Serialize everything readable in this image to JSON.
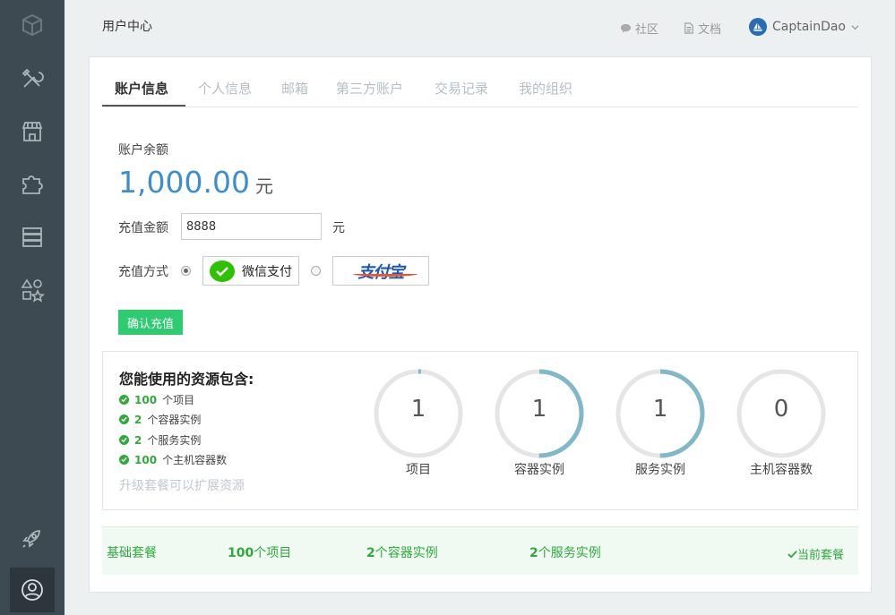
{
  "header": {
    "title": "用户中心",
    "community_label": "社区",
    "docs_label": "文档",
    "username": "CaptainDao"
  },
  "sidebar": {
    "items": [
      {
        "icon": "logo-cube-icon"
      },
      {
        "icon": "tools-icon"
      },
      {
        "icon": "store-icon"
      },
      {
        "icon": "puzzle-icon"
      },
      {
        "icon": "server-icon"
      },
      {
        "icon": "shapes-icon"
      },
      {
        "icon": "rocket-icon"
      },
      {
        "icon": "user-icon",
        "active": true
      }
    ]
  },
  "tabs": [
    {
      "label": "账户信息",
      "active": true
    },
    {
      "label": "个人信息"
    },
    {
      "label": "邮箱"
    },
    {
      "label": "第三方账户"
    },
    {
      "label": "交易记录"
    },
    {
      "label": "我的组织"
    }
  ],
  "account": {
    "balance_label": "账户余额",
    "balance": "1,000.00",
    "balance_unit": "元",
    "recharge_label": "充值金额",
    "recharge_value": "8888",
    "recharge_unit": "元",
    "method_label": "充值方式",
    "wechat_label": "微信支付",
    "alipay_label": "支付宝",
    "confirm_label": "确认充值"
  },
  "resources": {
    "title": "您能使用的资源包含:",
    "items": [
      {
        "count": "100",
        "text": "个项目"
      },
      {
        "count": "2",
        "text": "个容器实例"
      },
      {
        "count": "2",
        "text": "个服务实例"
      },
      {
        "count": "100",
        "text": "个主机容器数"
      }
    ],
    "upgrade_text": "升级套餐可以扩展资源",
    "gauges": [
      {
        "value": "1",
        "label": "项目",
        "fraction": 0.01
      },
      {
        "value": "1",
        "label": "容器实例",
        "fraction": 0.5
      },
      {
        "value": "1",
        "label": "服务实例",
        "fraction": 0.5
      },
      {
        "value": "0",
        "label": "主机容器数",
        "fraction": 0.0
      }
    ]
  },
  "plan": {
    "name": "基础套餐",
    "projects_count": "100",
    "projects_text": "个项目",
    "containers_count": "2",
    "containers_text": "个容器实例",
    "services_count": "2",
    "services_text": "个服务实例",
    "current_label": "当前套餐"
  },
  "colors": {
    "sidebar_bg": "#3e4a52",
    "accent_blue": "#3b8fd0",
    "green": "#2ecc71",
    "gauge_blue": "#7fb8c7"
  }
}
